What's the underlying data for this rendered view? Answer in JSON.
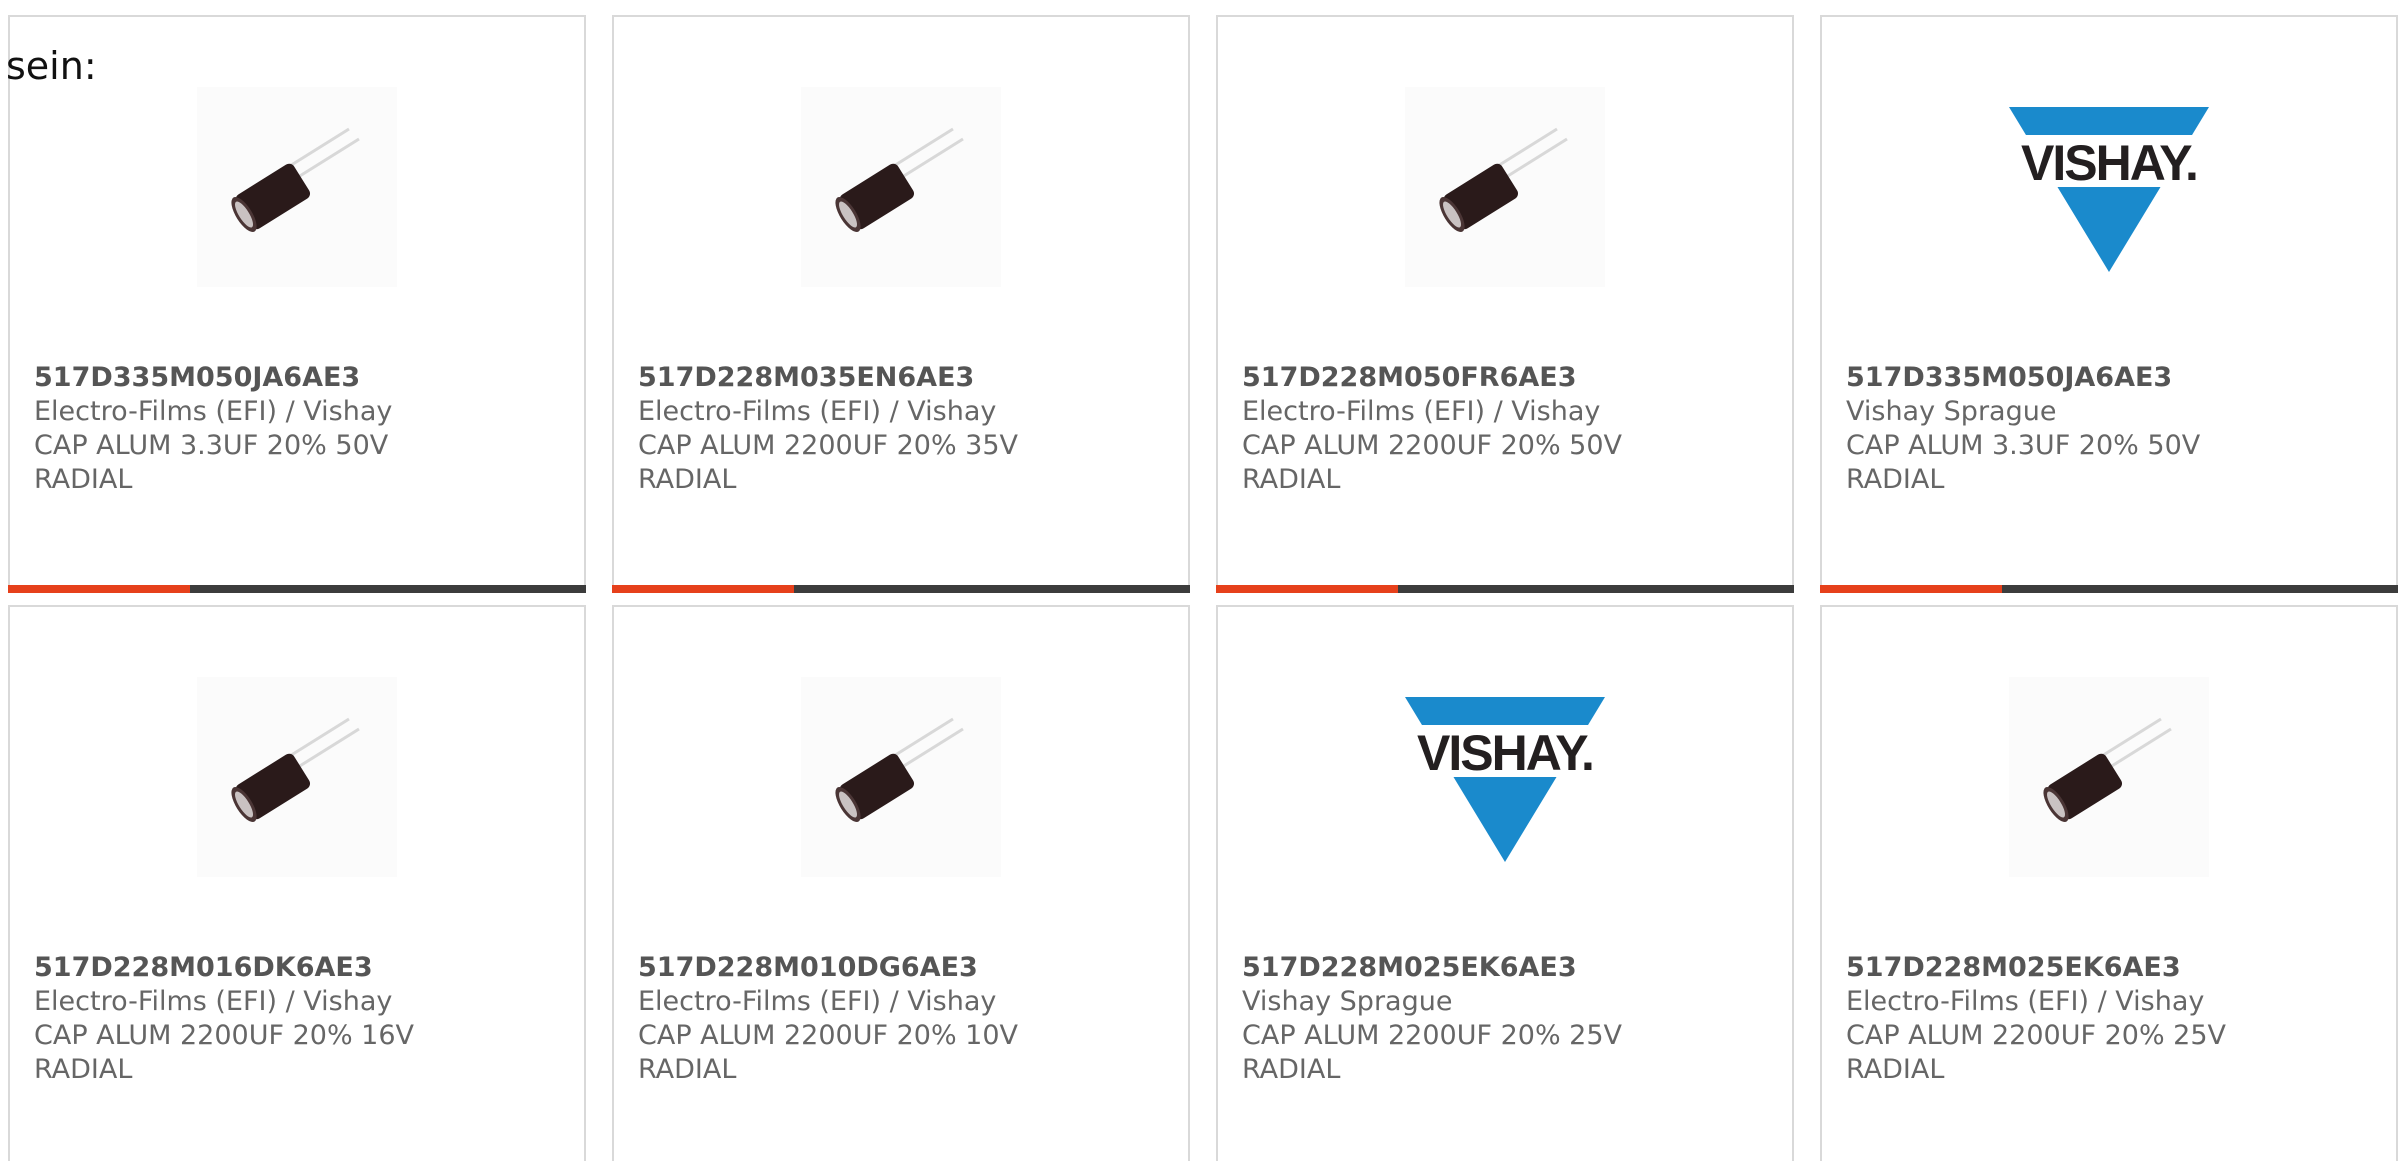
{
  "intro": "sein:",
  "colors": {
    "accent": "#e6401b",
    "bar": "#3c3c3c",
    "vishay_blue": "#1a8acc"
  },
  "products": [
    {
      "part": "517D335M050JA6AE3",
      "manufacturer": "Electro-Films (EFI) / Vishay",
      "desc1": "CAP ALUM 3.3UF 20% 50V",
      "desc2": "RADIAL",
      "image": "capacitor-icon"
    },
    {
      "part": "517D228M035EN6AE3",
      "manufacturer": "Electro-Films (EFI) / Vishay",
      "desc1": "CAP ALUM 2200UF 20% 35V",
      "desc2": "RADIAL",
      "image": "capacitor-icon"
    },
    {
      "part": "517D228M050FR6AE3",
      "manufacturer": "Electro-Films (EFI) / Vishay",
      "desc1": "CAP ALUM 2200UF 20% 50V",
      "desc2": "RADIAL",
      "image": "capacitor-icon"
    },
    {
      "part": "517D335M050JA6AE3",
      "manufacturer": "Vishay Sprague",
      "desc1": "CAP ALUM 3.3UF 20% 50V",
      "desc2": "RADIAL",
      "image": "vishay-logo"
    },
    {
      "part": "517D228M016DK6AE3",
      "manufacturer": "Electro-Films (EFI) / Vishay",
      "desc1": "CAP ALUM 2200UF 20% 16V",
      "desc2": "RADIAL",
      "image": "capacitor-icon"
    },
    {
      "part": "517D228M010DG6AE3",
      "manufacturer": "Electro-Films (EFI) / Vishay",
      "desc1": "CAP ALUM 2200UF 20% 10V",
      "desc2": "RADIAL",
      "image": "capacitor-icon"
    },
    {
      "part": "517D228M025EK6AE3",
      "manufacturer": "Vishay Sprague",
      "desc1": "CAP ALUM 2200UF 20% 25V",
      "desc2": "RADIAL",
      "image": "vishay-logo"
    },
    {
      "part": "517D228M025EK6AE3",
      "manufacturer": "Electro-Films (EFI) / Vishay",
      "desc1": "CAP ALUM 2200UF 20% 25V",
      "desc2": "RADIAL",
      "image": "capacitor-icon"
    }
  ],
  "vishay_logo_text": "VISHAY."
}
